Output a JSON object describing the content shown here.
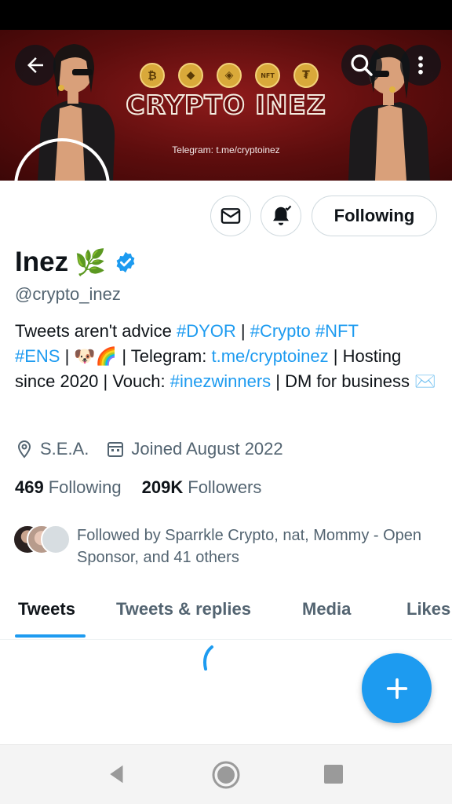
{
  "banner": {
    "coins": [
      "₿",
      "◆",
      "◈",
      "NFT",
      "₮"
    ],
    "title": "CRYPTO INEZ",
    "subtitle": "Telegram: t.me/cryptoinez"
  },
  "header": {
    "back_icon": "arrow-left-icon",
    "search_icon": "search-icon",
    "more_icon": "more-vertical-icon"
  },
  "actions": {
    "message_icon": "envelope-icon",
    "notify_icon": "bell-check-icon",
    "following_label": "Following"
  },
  "profile": {
    "name": "Inez",
    "name_emoji": "🌿",
    "verified": true,
    "handle": "@crypto_inez",
    "bio": {
      "t1": "Tweets aren't advice ",
      "l1": "#DYOR",
      "t2": " | ",
      "l2": "#Crypto",
      "t3": " ",
      "l3": "#NFT",
      "l4": "#ENS",
      "t4": " | 🐶🌈 | Telegram: ",
      "l5": "t.me/cryptoinez",
      "t5": " | Hosting since 2020 | Vouch: ",
      "l6": "#inezwinners",
      "t6": " | DM for business ✉️"
    },
    "location": "S.E.A.",
    "joined": "Joined August 2022",
    "following_count": "469",
    "following_label": "Following",
    "followers_count": "209K",
    "followers_label": "Followers",
    "followed_by": "Followed by Sparrkle Crypto, nat, Mommy - Open Sponsor, and 41 others"
  },
  "tabs": [
    {
      "label": "Tweets",
      "active": true
    },
    {
      "label": "Tweets & replies",
      "active": false
    },
    {
      "label": "Media",
      "active": false
    },
    {
      "label": "Likes",
      "active": false
    }
  ],
  "fab": {
    "icon": "plus-icon"
  },
  "nav": {
    "back_icon": "triangle-back-icon",
    "home_icon": "circle-home-icon",
    "recents_icon": "square-recents-icon"
  },
  "colors": {
    "accent": "#1d9bf0",
    "text": "#0f1419",
    "muted": "#536471",
    "banner": "#6b0c0c"
  }
}
